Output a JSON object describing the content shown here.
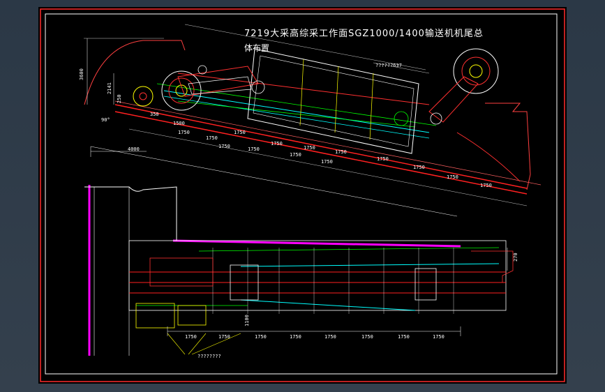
{
  "drawing": {
    "title": "7219大采高综采工作面SGZ1000/1400输送机机尾总",
    "subtitle": "体布置"
  },
  "upper_view": {
    "dim_top_right": "??????637",
    "dim_left_vertical": "3600",
    "dim_left_small_1": "2141",
    "dim_left_small_2": "250",
    "dim_angle": "90°",
    "dim_base": "4000",
    "dim_1500": "1500",
    "dim_350": "350",
    "pitch_labels": [
      "1750",
      "1750",
      "1750",
      "1750",
      "1750",
      "1750",
      "1750",
      "1750",
      "1750",
      "1750",
      "1750",
      "1750",
      "1750",
      "1750"
    ]
  },
  "lower_view": {
    "dim_right": "270",
    "dim_left": "1100",
    "pitch_labels": [
      "1750",
      "1750",
      "1750",
      "1750",
      "1750",
      "1750",
      "1750",
      "1750"
    ],
    "callout": "????????"
  },
  "colors": {
    "frame": "#ff2a2a",
    "inner_frame": "#ffffff",
    "belt_red": "#ff2020",
    "cyan": "#00ffff",
    "green": "#00ff00",
    "yellow": "#ffff00",
    "magenta": "#ff00ff",
    "white": "#ffffff"
  }
}
